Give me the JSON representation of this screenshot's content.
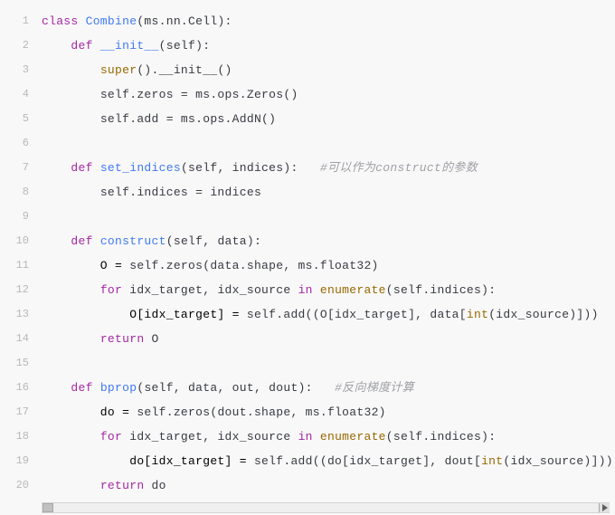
{
  "code": {
    "lines": [
      {
        "n": 1,
        "tokens": [
          {
            "cls": "kw",
            "t": "class "
          },
          {
            "cls": "cls",
            "t": "Combine"
          },
          {
            "cls": "pun",
            "t": "(ms.nn.Cell):"
          }
        ]
      },
      {
        "n": 2,
        "tokens": [
          {
            "cls": "tok",
            "t": "    "
          },
          {
            "cls": "kw",
            "t": "def "
          },
          {
            "cls": "fn",
            "t": "__init__"
          },
          {
            "cls": "pun",
            "t": "("
          },
          {
            "cls": "self",
            "t": "self"
          },
          {
            "cls": "pun",
            "t": "):"
          }
        ]
      },
      {
        "n": 3,
        "tokens": [
          {
            "cls": "tok",
            "t": "        "
          },
          {
            "cls": "bi",
            "t": "super"
          },
          {
            "cls": "pun",
            "t": "().__init__()"
          }
        ]
      },
      {
        "n": 4,
        "tokens": [
          {
            "cls": "tok",
            "t": "        "
          },
          {
            "cls": "self",
            "t": "self"
          },
          {
            "cls": "pun",
            "t": ".zeros = ms.ops.Zeros()"
          }
        ]
      },
      {
        "n": 5,
        "tokens": [
          {
            "cls": "tok",
            "t": "        "
          },
          {
            "cls": "self",
            "t": "self"
          },
          {
            "cls": "pun",
            "t": ".add = ms.ops.AddN()"
          }
        ]
      },
      {
        "n": 6,
        "tokens": []
      },
      {
        "n": 7,
        "tokens": [
          {
            "cls": "tok",
            "t": "    "
          },
          {
            "cls": "kw",
            "t": "def "
          },
          {
            "cls": "fn",
            "t": "set_indices"
          },
          {
            "cls": "pun",
            "t": "("
          },
          {
            "cls": "self",
            "t": "self"
          },
          {
            "cls": "pun",
            "t": ", indices):   "
          },
          {
            "cls": "com",
            "t": "#可以作为construct的参数"
          }
        ]
      },
      {
        "n": 8,
        "tokens": [
          {
            "cls": "tok",
            "t": "        "
          },
          {
            "cls": "self",
            "t": "self"
          },
          {
            "cls": "pun",
            "t": ".indices = indices"
          }
        ]
      },
      {
        "n": 9,
        "tokens": []
      },
      {
        "n": 10,
        "tokens": [
          {
            "cls": "tok",
            "t": "    "
          },
          {
            "cls": "kw",
            "t": "def "
          },
          {
            "cls": "fn",
            "t": "construct"
          },
          {
            "cls": "pun",
            "t": "("
          },
          {
            "cls": "self",
            "t": "self"
          },
          {
            "cls": "pun",
            "t": ", data):"
          }
        ]
      },
      {
        "n": 11,
        "tokens": [
          {
            "cls": "tok",
            "t": "        O = "
          },
          {
            "cls": "self",
            "t": "self"
          },
          {
            "cls": "pun",
            "t": ".zeros(data.shape, ms.float32)"
          }
        ]
      },
      {
        "n": 12,
        "tokens": [
          {
            "cls": "tok",
            "t": "        "
          },
          {
            "cls": "kw",
            "t": "for"
          },
          {
            "cls": "pun",
            "t": " idx_target, idx_source "
          },
          {
            "cls": "kw",
            "t": "in"
          },
          {
            "cls": "pun",
            "t": " "
          },
          {
            "cls": "bi",
            "t": "enumerate"
          },
          {
            "cls": "pun",
            "t": "("
          },
          {
            "cls": "self",
            "t": "self"
          },
          {
            "cls": "pun",
            "t": ".indices):"
          }
        ]
      },
      {
        "n": 13,
        "tokens": [
          {
            "cls": "tok",
            "t": "            O[idx_target] = "
          },
          {
            "cls": "self",
            "t": "self"
          },
          {
            "cls": "pun",
            "t": ".add((O[idx_target], data["
          },
          {
            "cls": "bi",
            "t": "int"
          },
          {
            "cls": "pun",
            "t": "(idx_source)]))"
          }
        ]
      },
      {
        "n": 14,
        "tokens": [
          {
            "cls": "tok",
            "t": "        "
          },
          {
            "cls": "kw",
            "t": "return"
          },
          {
            "cls": "pun",
            "t": " O"
          }
        ]
      },
      {
        "n": 15,
        "tokens": []
      },
      {
        "n": 16,
        "tokens": [
          {
            "cls": "tok",
            "t": "    "
          },
          {
            "cls": "kw",
            "t": "def "
          },
          {
            "cls": "fn",
            "t": "bprop"
          },
          {
            "cls": "pun",
            "t": "("
          },
          {
            "cls": "self",
            "t": "self"
          },
          {
            "cls": "pun",
            "t": ", data, out, dout):   "
          },
          {
            "cls": "com",
            "t": "#反向梯度计算"
          }
        ]
      },
      {
        "n": 17,
        "tokens": [
          {
            "cls": "tok",
            "t": "        do = "
          },
          {
            "cls": "self",
            "t": "self"
          },
          {
            "cls": "pun",
            "t": ".zeros(dout.shape, ms.float32)"
          }
        ]
      },
      {
        "n": 18,
        "tokens": [
          {
            "cls": "tok",
            "t": "        "
          },
          {
            "cls": "kw",
            "t": "for"
          },
          {
            "cls": "pun",
            "t": " idx_target, idx_source "
          },
          {
            "cls": "kw",
            "t": "in"
          },
          {
            "cls": "pun",
            "t": " "
          },
          {
            "cls": "bi",
            "t": "enumerate"
          },
          {
            "cls": "pun",
            "t": "("
          },
          {
            "cls": "self",
            "t": "self"
          },
          {
            "cls": "pun",
            "t": ".indices):"
          }
        ]
      },
      {
        "n": 19,
        "tokens": [
          {
            "cls": "tok",
            "t": "            do[idx_target] = "
          },
          {
            "cls": "self",
            "t": "self"
          },
          {
            "cls": "pun",
            "t": ".add((do[idx_target], dout["
          },
          {
            "cls": "bi",
            "t": "int"
          },
          {
            "cls": "pun",
            "t": "(idx_source)]))"
          }
        ]
      },
      {
        "n": 20,
        "tokens": [
          {
            "cls": "tok",
            "t": "        "
          },
          {
            "cls": "kw",
            "t": "return"
          },
          {
            "cls": "pun",
            "t": " do"
          }
        ]
      }
    ]
  }
}
